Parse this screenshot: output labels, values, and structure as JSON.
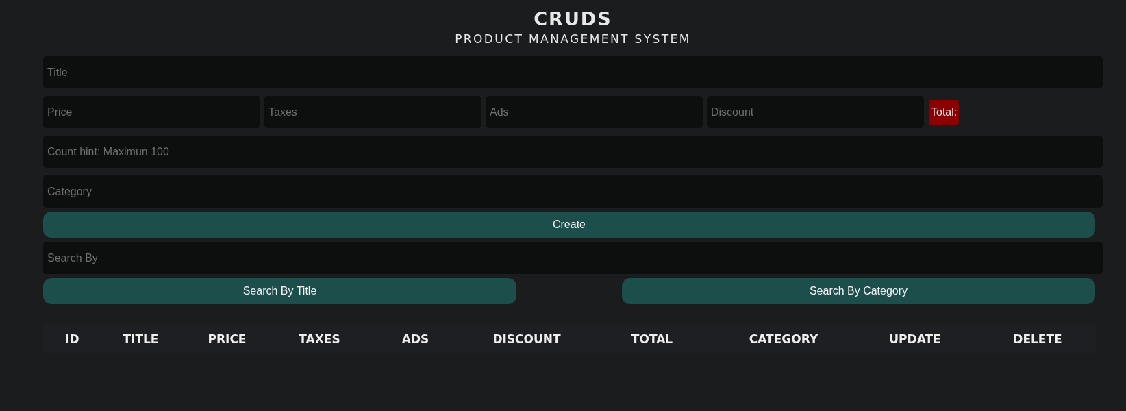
{
  "header": {
    "title": "CRUDS",
    "subtitle": "PRODUCT MANAGEMENT SYSTEM"
  },
  "title_field": {
    "placeholder": "Title"
  },
  "price_fields": [
    {
      "placeholder": "Price"
    },
    {
      "placeholder": "Taxes"
    },
    {
      "placeholder": "Ads"
    },
    {
      "placeholder": "Discount"
    }
  ],
  "total": {
    "label": "Total:"
  },
  "count_field": {
    "placeholder": "Count hint: Maximun 100"
  },
  "category_field": {
    "placeholder": "Category"
  },
  "create_button": {
    "label": "Create"
  },
  "search_field": {
    "placeholder": "Search By"
  },
  "search_buttons": [
    {
      "label": "Search By Title"
    },
    {
      "label": "Search By Category"
    }
  ],
  "table": {
    "columns": [
      "ID",
      "TITLE",
      "PRICE",
      "TAXES",
      "ADS",
      "DISCOUNT",
      "TOTAL",
      "CATEGORY",
      "UPDATE",
      "DELETE"
    ]
  }
}
